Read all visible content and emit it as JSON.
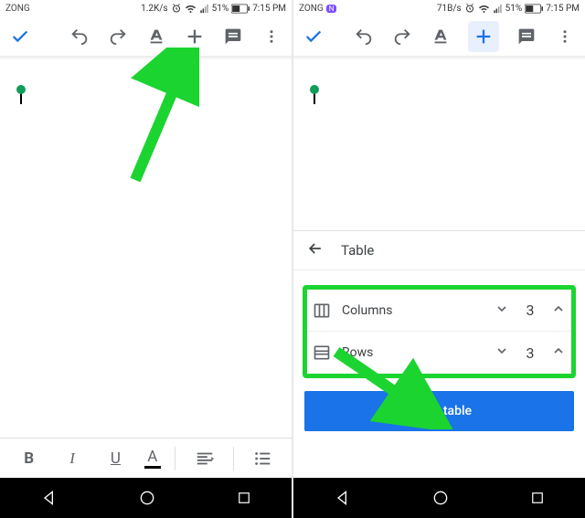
{
  "left": {
    "status": {
      "carrier": "ZONG",
      "speed": "1.2K/s",
      "battery_pct": "51%",
      "time": "7:15 PM"
    }
  },
  "right": {
    "status": {
      "carrier": "ZONG",
      "speed": "71B/s",
      "battery_pct": "51%",
      "time": "7:15 PM"
    },
    "panel": {
      "title": "Table",
      "columns_label": "Columns",
      "columns_value": "3",
      "rows_label": "Rows",
      "rows_value": "3",
      "insert_label": "Insert table"
    }
  }
}
